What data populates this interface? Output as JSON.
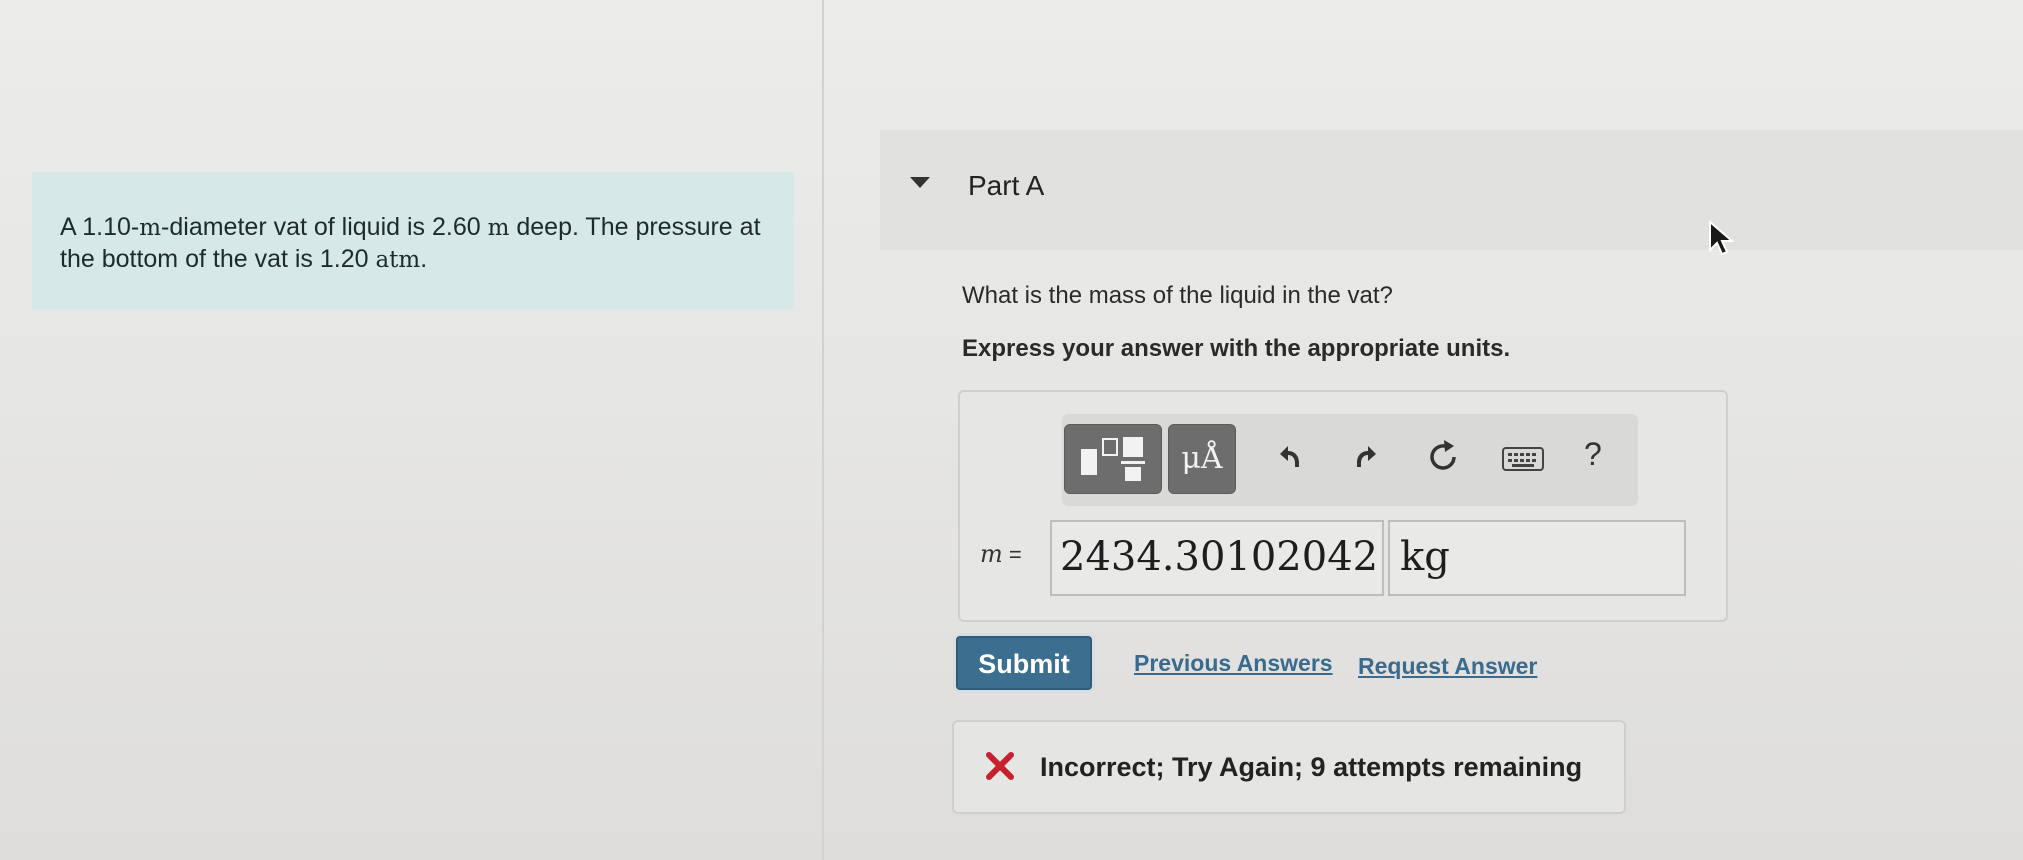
{
  "problem": {
    "text_before_m": "A 1.10-",
    "unit_m": "m",
    "text_after_m": "-diameter vat of liquid is 2.60 ",
    "unit_m2": "m",
    "text_mid": " deep. The pressure at the bottom of the vat is 1.20 ",
    "unit_atm": "atm",
    "text_end": "."
  },
  "part": {
    "title": "Part A"
  },
  "question": {
    "prompt": "What is the mass of the liquid in the vat?",
    "instruction": "Express your answer with the appropriate units."
  },
  "toolbar": {
    "units_label": "μÅ",
    "help_label": "?"
  },
  "answer": {
    "variable": "m",
    "equals": " =",
    "value": "2434.30102042",
    "unit": "kg"
  },
  "actions": {
    "submit_label": "Submit",
    "previous_answers_label": "Previous Answers",
    "request_answer_label": "Request Answer"
  },
  "feedback": {
    "message": "Incorrect; Try Again; 9 attempts remaining",
    "status_color": "#c8202f"
  },
  "colors": {
    "problem_bg": "#d6e8e8",
    "submit_bg": "#3c6e90",
    "link": "#3a6b8c"
  }
}
